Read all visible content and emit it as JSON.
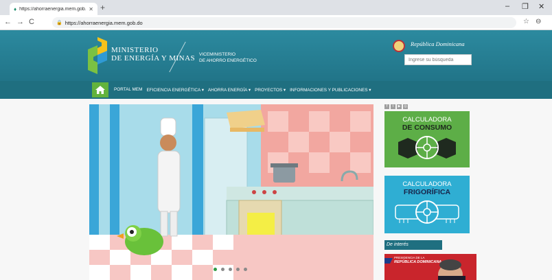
{
  "browser": {
    "tab_title": "https://ahorraenergia.mem.gob.",
    "url": "https://ahorraenergia.mem.gob.do"
  },
  "header": {
    "ministry_line1": "MINISTERIO",
    "ministry_line2": "DE ENERGÍA Y MINAS",
    "vice_line1": "VICEMINISTERIO",
    "vice_line2": "DE AHORRO ENERGÉTICO",
    "republic": "República Dominicana",
    "search_placeholder": "Ingrese su búsqueda"
  },
  "menu": {
    "items": [
      "PORTAL MEM",
      "EFICIENCIA ENERGÉTICA",
      "AHORRA ENERGÍA",
      "PROYECTOS",
      "INFORMACIONES Y PUBLICACIONES"
    ]
  },
  "sidebar": {
    "calc1_line1": "CALCULADORA",
    "calc1_line2": "DE CONSUMO",
    "calc2_line1": "CALCULADORA",
    "calc2_line2": "FRIGORÍFICA",
    "interes": "De interés",
    "banner_line1": "PRESIDENCIA DE LA",
    "banner_line2": "REPÚBLICA DOMINICANA"
  },
  "colors": {
    "header": "#217488",
    "menubar": "#1f6f80",
    "green": "#5dae47",
    "blue": "#2faed3"
  }
}
